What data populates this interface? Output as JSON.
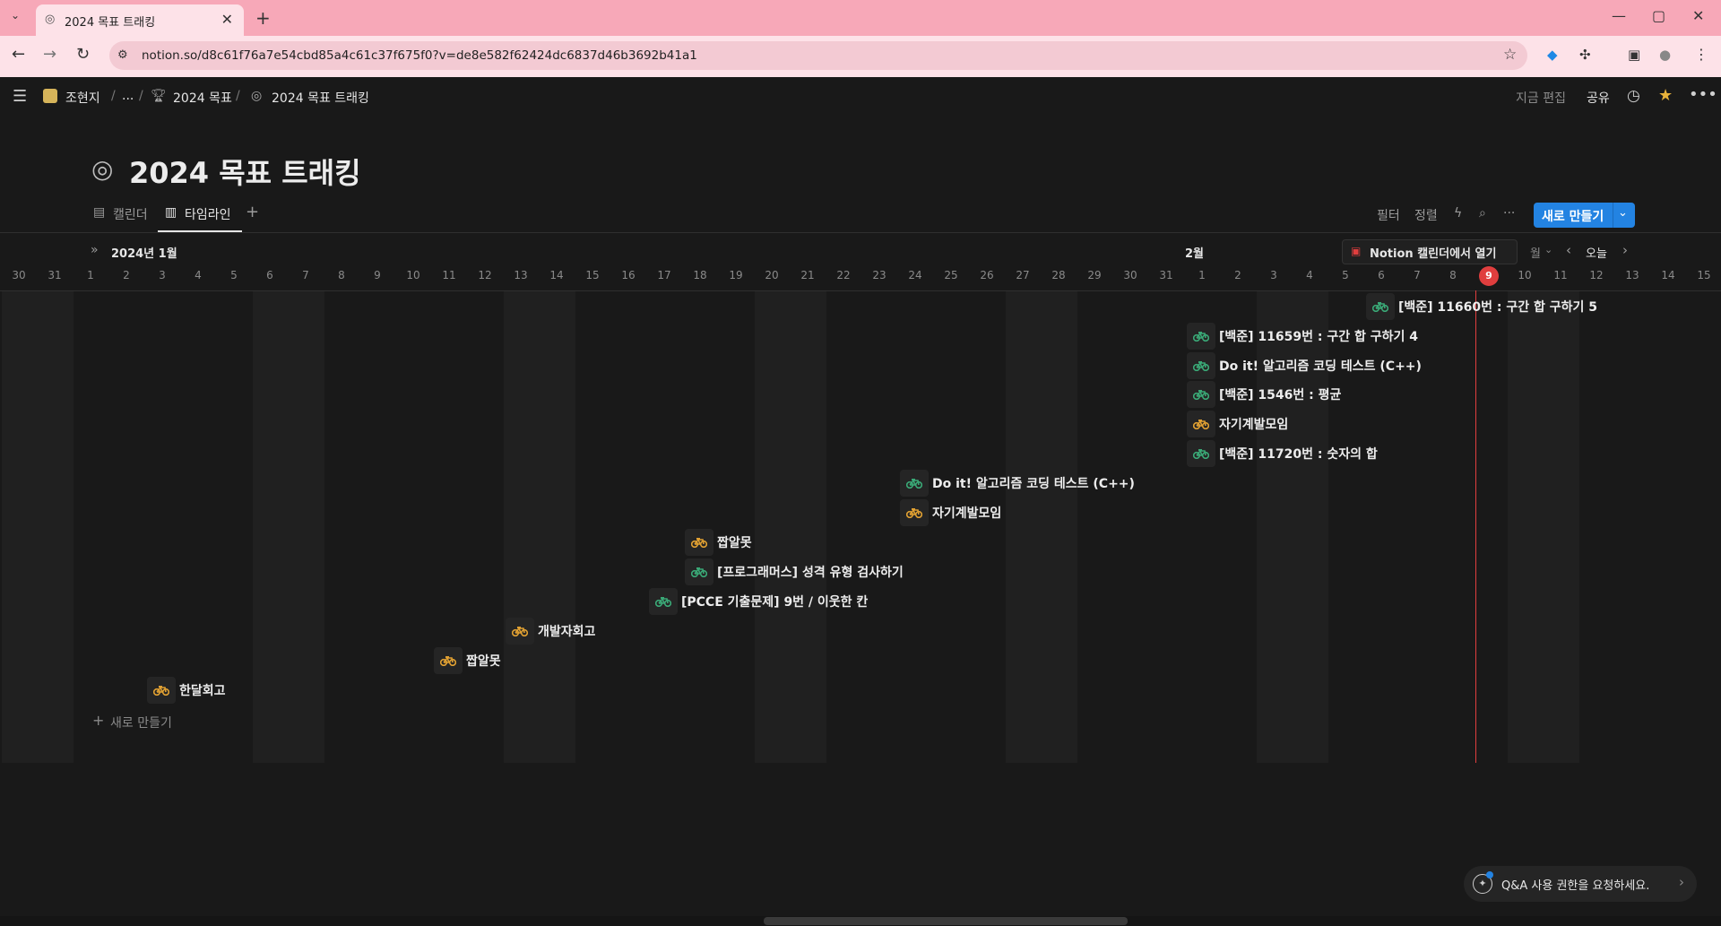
{
  "browser": {
    "tab_title": "2024 목표 트래킹",
    "url": "notion.so/d8c61f76a7e54cbd85a4c61c37f675f0?v=de8e582f62424dc6837d46b3692b41a1",
    "new_tab": "+",
    "close": "✕"
  },
  "header": {
    "breadcrumb": [
      "조현지",
      "...",
      "2024 목표",
      "2024 목표 트래킹"
    ],
    "edited": "지금 편집",
    "share": "공유"
  },
  "page": {
    "title": "2024 목표 트래킹",
    "tabs": [
      {
        "label": "캘린더",
        "active": false
      },
      {
        "label": "타임라인",
        "active": true
      }
    ],
    "add_view": "+",
    "tools": {
      "filter": "필터",
      "sort": "정렬",
      "new": "새로 만들기"
    }
  },
  "timeline": {
    "month_label": "2024년 1월",
    "feb_label": "2월",
    "open_calendar": "Notion 캘린더에서 열기",
    "scale": "월",
    "today_btn": "오늘",
    "today_day": "9",
    "days": [
      "30",
      "31",
      "1",
      "2",
      "3",
      "4",
      "5",
      "6",
      "7",
      "8",
      "9",
      "10",
      "11",
      "12",
      "13",
      "14",
      "15",
      "16",
      "17",
      "18",
      "19",
      "20",
      "21",
      "22",
      "23",
      "24",
      "25",
      "26",
      "27",
      "28",
      "29",
      "30",
      "31",
      "1",
      "2",
      "3",
      "4",
      "5",
      "6",
      "7",
      "8",
      "9",
      "10",
      "11",
      "12",
      "13",
      "14",
      "15"
    ],
    "new_item": "새로 만들기",
    "items": [
      {
        "label": "[백준] 11660번 : 구간 합 구하기 5",
        "icon_color": "green"
      },
      {
        "label": "[백준] 11659번 : 구간 합 구하기 4",
        "icon_color": "green"
      },
      {
        "label": "Do it! 알고리즘 코딩 테스트 (C++)",
        "icon_color": "green"
      },
      {
        "label": "[백준] 1546번 : 평균",
        "icon_color": "green"
      },
      {
        "label": "자기계발모임",
        "icon_color": "orange"
      },
      {
        "label": "[백준] 11720번 : 숫자의 합",
        "icon_color": "green"
      },
      {
        "label": "Do it! 알고리즘 코딩 테스트 (C++)",
        "icon_color": "green"
      },
      {
        "label": "자기계발모임",
        "icon_color": "orange"
      },
      {
        "label": "짭알못",
        "icon_color": "orange"
      },
      {
        "label": "[프로그래머스] 성격 유형 검사하기",
        "icon_color": "green"
      },
      {
        "label": "[PCCE 기출문제] 9번 / 이웃한 칸",
        "icon_color": "green"
      },
      {
        "label": "개발자회고",
        "icon_color": "orange"
      },
      {
        "label": "짭알못",
        "icon_color": "orange"
      },
      {
        "label": "한달회고",
        "icon_color": "orange"
      }
    ]
  },
  "qa": {
    "text": "Q&A 사용 권한을 요청하세요."
  },
  "colors": {
    "green": "#3aa876",
    "orange": "#e0a032",
    "accent": "#2383e2",
    "today": "#e03e3e"
  }
}
